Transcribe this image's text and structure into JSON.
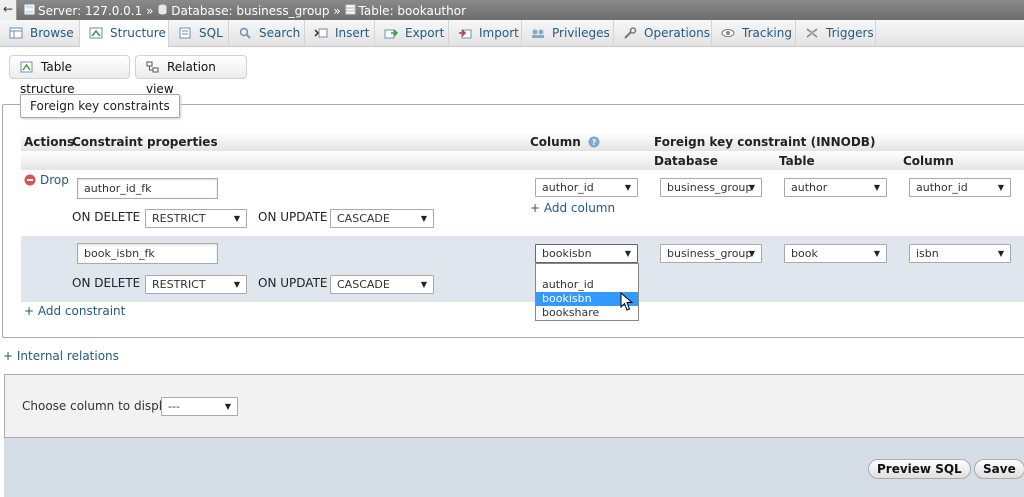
{
  "breadcrumb": {
    "back": "←",
    "server": "Server: 127.0.0.1",
    "sep": "»",
    "database": "Database: business_group",
    "table": "Table: bookauthor"
  },
  "tabs": [
    {
      "label": "Browse",
      "icon": "browse-icon"
    },
    {
      "label": "Structure",
      "icon": "structure-icon"
    },
    {
      "label": "SQL",
      "icon": "sql-icon"
    },
    {
      "label": "Search",
      "icon": "search-icon"
    },
    {
      "label": "Insert",
      "icon": "insert-icon"
    },
    {
      "label": "Export",
      "icon": "export-icon"
    },
    {
      "label": "Import",
      "icon": "import-icon"
    },
    {
      "label": "Privileges",
      "icon": "privileges-icon"
    },
    {
      "label": "Operations",
      "icon": "operations-icon"
    },
    {
      "label": "Tracking",
      "icon": "tracking-icon"
    },
    {
      "label": "Triggers",
      "icon": "triggers-icon"
    }
  ],
  "subnav": {
    "table_structure": "Table structure",
    "relation_view": "Relation view"
  },
  "fk": {
    "legend": "Foreign key constraints",
    "headers": {
      "actions": "Actions",
      "constraint_properties": "Constraint properties",
      "column": "Column",
      "fk_constraint": "Foreign key constraint (INNODB)",
      "database": "Database",
      "table": "Table",
      "ref_column": "Column"
    },
    "rows": [
      {
        "drop": "Drop",
        "name": "author_id_fk",
        "on_delete_label": "ON DELETE",
        "on_delete": "RESTRICT",
        "on_update_label": "ON UPDATE",
        "on_update": "CASCADE",
        "column": "author_id",
        "add_column": "+ Add column",
        "database": "business_group",
        "table": "author",
        "ref_column": "author_id"
      },
      {
        "name": "book_isbn_fk",
        "on_delete_label": "ON DELETE",
        "on_delete": "RESTRICT",
        "on_update_label": "ON UPDATE",
        "on_update": "CASCADE",
        "column": "bookisbn",
        "database": "business_group",
        "table": "book",
        "ref_column": "isbn"
      }
    ],
    "column_options": [
      {
        "label": "",
        "selected": false
      },
      {
        "label": "author_id",
        "selected": false
      },
      {
        "label": "bookisbn",
        "selected": true
      },
      {
        "label": "bookshare",
        "selected": false
      }
    ],
    "add_constraint": "+ Add constraint"
  },
  "internal_relations": "+ Internal relations",
  "display": {
    "label": "Choose column to display:",
    "value": "---"
  },
  "footer": {
    "preview_sql": "Preview SQL",
    "save": "Save"
  },
  "colors": {
    "link": "#235a81",
    "selected_option": "#3399ff",
    "row_alt": "#dfe6ee",
    "drop_icon": "#d9534f"
  }
}
